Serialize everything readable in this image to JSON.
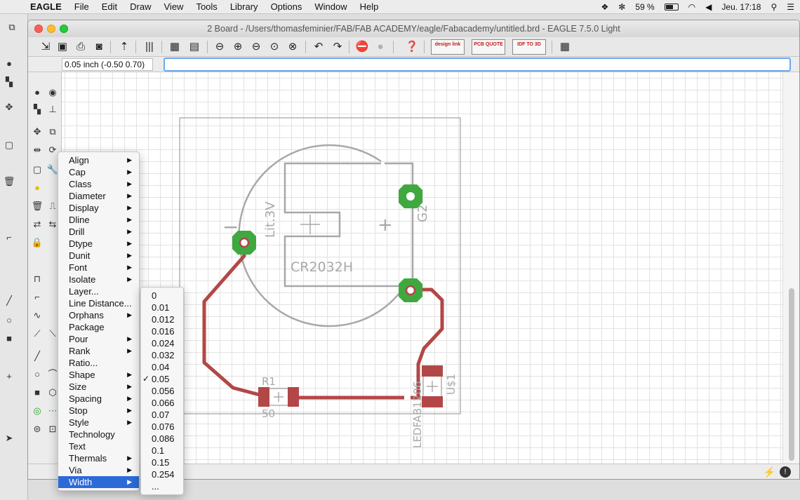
{
  "menubar": {
    "app_name": "EAGLE",
    "items": [
      "File",
      "Edit",
      "Draw",
      "View",
      "Tools",
      "Library",
      "Options",
      "Window",
      "Help"
    ],
    "battery": "59 %",
    "clock": "Jeu. 17:18"
  },
  "window": {
    "title": "2 Board - /Users/thomasfeminier/FAB/FAB ACADEMY/eagle/Fabacademy/untitled.brd - EAGLE 7.5.0 Light"
  },
  "toolbar": {
    "designlink_label": "design link",
    "pcb_quote_label": "PCB QUOTE",
    "idf_label": "IDF TO 3D"
  },
  "cmdbar": {
    "coordinates": "0.05 inch (-0.50 0.70)",
    "command_value": ""
  },
  "board": {
    "holder_name": "CR2032H",
    "holder_value": "Lit.3V",
    "holder_ref": "G2",
    "minus_symbol": "−",
    "plus_symbol": "+",
    "resistor_name": "R1",
    "resistor_value": "50",
    "led_name": "U$1",
    "led_value": "LEDFAB1206"
  },
  "attribute_menu": {
    "items": [
      {
        "label": "Align",
        "submenu": true
      },
      {
        "label": "Cap",
        "submenu": true
      },
      {
        "label": "Class",
        "submenu": true
      },
      {
        "label": "Diameter",
        "submenu": true
      },
      {
        "label": "Display",
        "submenu": true
      },
      {
        "label": "Dline",
        "submenu": true
      },
      {
        "label": "Drill",
        "submenu": true
      },
      {
        "label": "Dtype",
        "submenu": true
      },
      {
        "label": "Dunit",
        "submenu": true
      },
      {
        "label": "Font",
        "submenu": true
      },
      {
        "label": "Isolate",
        "submenu": true
      },
      {
        "label": "Layer...",
        "submenu": false
      },
      {
        "label": "Line Distance...",
        "submenu": false
      },
      {
        "label": "Orphans",
        "submenu": true
      },
      {
        "label": "Package",
        "submenu": false
      },
      {
        "label": "Pour",
        "submenu": true
      },
      {
        "label": "Rank",
        "submenu": true
      },
      {
        "label": "Ratio...",
        "submenu": false
      },
      {
        "label": "Shape",
        "submenu": true
      },
      {
        "label": "Size",
        "submenu": true
      },
      {
        "label": "Spacing",
        "submenu": true
      },
      {
        "label": "Stop",
        "submenu": true
      },
      {
        "label": "Style",
        "submenu": true
      },
      {
        "label": "Technology",
        "submenu": false
      },
      {
        "label": "Text",
        "submenu": false
      },
      {
        "label": "Thermals",
        "submenu": true
      },
      {
        "label": "Via",
        "submenu": true
      },
      {
        "label": "Width",
        "submenu": true
      }
    ],
    "selected": "Width"
  },
  "width_menu": {
    "items": [
      "0",
      "0.01",
      "0.012",
      "0.016",
      "0.024",
      "0.032",
      "0.04",
      "0.05",
      "0.056",
      "0.066",
      "0.07",
      "0.076",
      "0.086",
      "0.1",
      "0.15",
      "0.254",
      "..."
    ],
    "checked": "0.05"
  },
  "colors": {
    "trace": "#b34747",
    "pad": "#3fa83f",
    "outline": "#a0a0a0",
    "menu_highlight": "#2c6ad8"
  }
}
